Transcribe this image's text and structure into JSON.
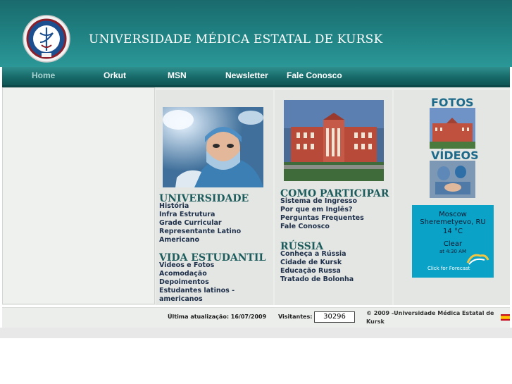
{
  "header": {
    "title": "UNIVERSIDADE MÉDICA ESTATAL DE KURSK"
  },
  "nav": {
    "items": [
      "Home",
      "Orkut",
      "MSN",
      "Newsletter",
      "Fale Conosco"
    ]
  },
  "universidade": {
    "heading": "UNIVERSIDADE",
    "links": [
      "História",
      "Infra Estrutura",
      "Grade Curricular",
      "Representante Latino",
      "Americano"
    ]
  },
  "vida": {
    "heading": "VIDA ESTUDANTIL",
    "links": [
      "Videos e Fotos",
      "Acomodação",
      "Depoimentos",
      "Estudantes latinos -",
      "americanos"
    ]
  },
  "como": {
    "heading": "COMO PARTICIPAR",
    "links": [
      "Sistema de Ingresso",
      "Por que em Inglês?",
      "Perguntas Frequentes",
      "Fale Conosco"
    ]
  },
  "russia": {
    "heading": "RÚSSIA",
    "links": [
      "Conheça a Rússia",
      "Cidade de Kursk",
      "Educação Russa",
      "Tratado de Bolonha"
    ]
  },
  "media": {
    "fotos_label": "FOTOS",
    "videos_label": "VÍDEOS"
  },
  "weather": {
    "location_line1": "Moscow",
    "location_line2": "Sheremetyevo, RU",
    "temp": "14 °C",
    "condition": "Clear",
    "time": "at 4:30 AM",
    "link": "Click for Forecast"
  },
  "footer": {
    "last_update": "Última atualização: 16/07/2009",
    "visitors_label": "Visitantes:",
    "visitors_count": "30296",
    "copyright": "© 2009 -Universidade Médica Estatal de Kursk"
  },
  "colors": {
    "header": "#1f7f80",
    "nav": "#176a69",
    "heading": "#1d5c5c",
    "link": "#1e2f4a",
    "weather_bg": "#0aa3c7"
  }
}
